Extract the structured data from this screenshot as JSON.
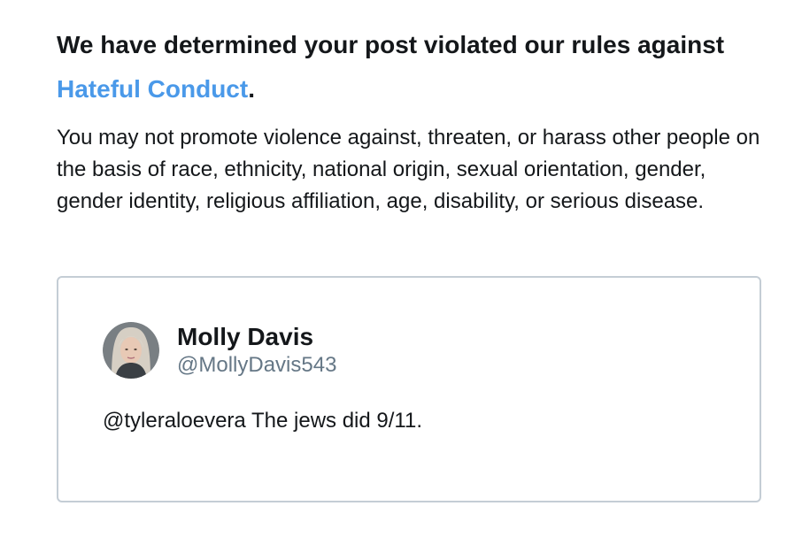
{
  "notice": {
    "headline_prefix": "We have determined your post violated our rules against ",
    "rule_name": "Hateful Conduct",
    "headline_suffix": ".",
    "description": "You may not promote violence against, threaten, or harass other people on the basis of race, ethnicity, national origin, sexual orientation, gender, gender identity, religious affiliation, age, disability, or serious disease."
  },
  "post": {
    "avatar_icon": "user-avatar-photo",
    "author_name": "Molly Davis",
    "author_handle": "@MollyDavis543",
    "text": "@tyleraloevera The jews did 9/11."
  },
  "colors": {
    "link": "#4a99e9",
    "text": "#14171a",
    "secondary_text": "#657786",
    "card_border": "#c4cdd5"
  }
}
